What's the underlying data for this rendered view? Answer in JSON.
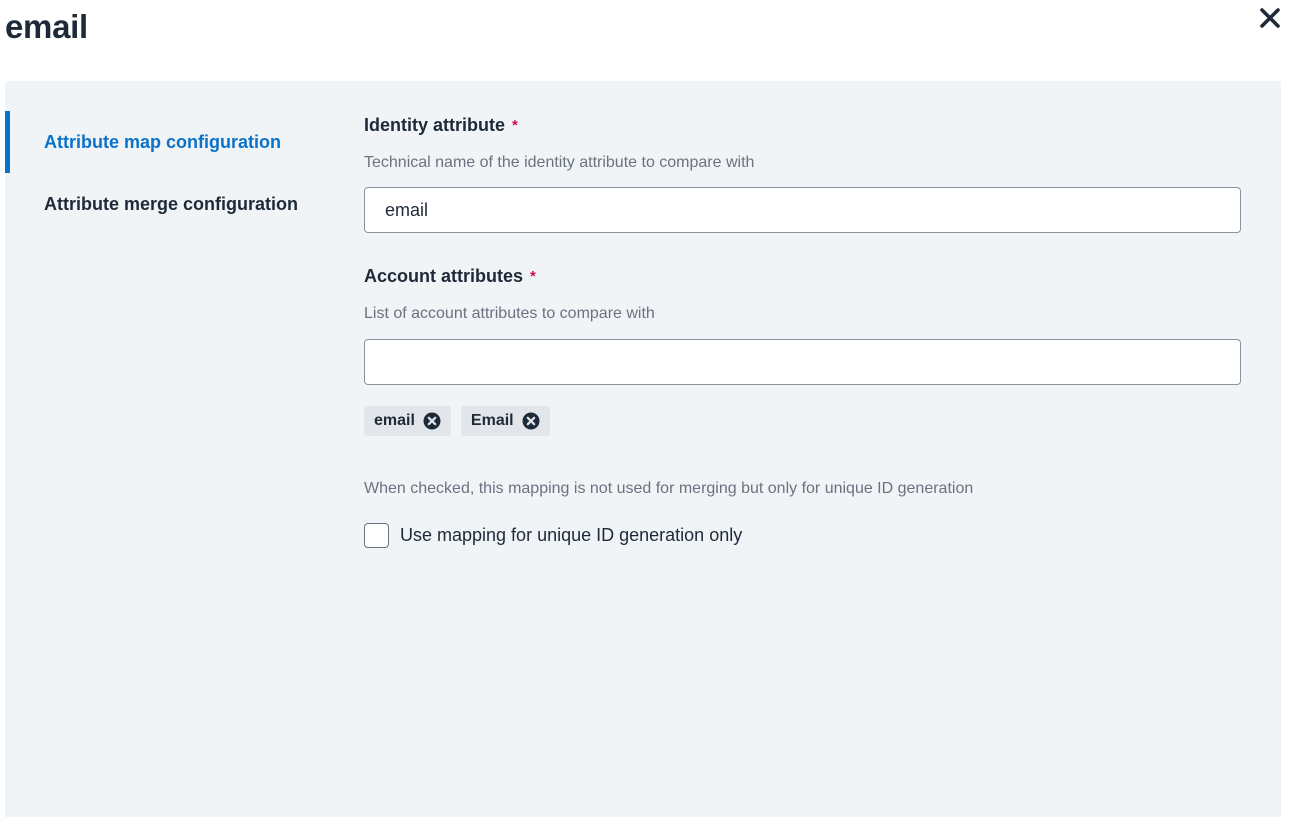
{
  "dialog": {
    "title": "email",
    "close_icon": "close-icon"
  },
  "nav": {
    "items": [
      {
        "label": "Attribute map configuration",
        "active": true
      },
      {
        "label": "Attribute merge configuration",
        "active": false
      }
    ]
  },
  "form": {
    "identity_attribute": {
      "label": "Identity attribute",
      "required_marker": "*",
      "hint": "Technical name of the identity attribute to compare with",
      "value": "email"
    },
    "account_attributes": {
      "label": "Account attributes",
      "required_marker": "*",
      "hint": "List of account attributes to compare with",
      "value": "",
      "chips": [
        {
          "label": "email",
          "remove_icon": "remove-circle-icon"
        },
        {
          "label": "Email",
          "remove_icon": "remove-circle-icon"
        }
      ]
    },
    "unique_id": {
      "hint": "When checked, this mapping is not used for merging but only for unique ID generation",
      "checkbox_label": "Use mapping for unique ID generation only",
      "checked": false
    }
  },
  "colors": {
    "accent": "#0b72c9",
    "required": "#d0104c",
    "panel_bg": "#f1f4f7",
    "chip_bg": "#e2e6ea"
  }
}
